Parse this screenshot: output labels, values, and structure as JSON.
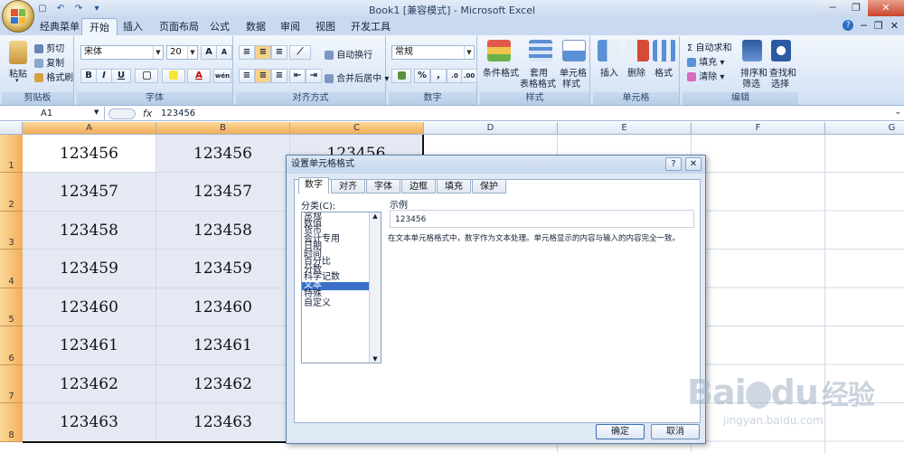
{
  "window": {
    "title": "Book1 [兼容模式] - Microsoft Excel",
    "controls": {
      "minimize": "─",
      "restore": "❐",
      "close": "✕"
    }
  },
  "qat": {
    "save_icon": "save-icon",
    "undo": "↶",
    "redo": "↷",
    "more": "▾"
  },
  "tabs": [
    {
      "label": "经典菜单",
      "active": false
    },
    {
      "label": "开始",
      "active": true
    },
    {
      "label": "插入",
      "active": false
    },
    {
      "label": "页面布局",
      "active": false
    },
    {
      "label": "公式",
      "active": false
    },
    {
      "label": "数据",
      "active": false
    },
    {
      "label": "审阅",
      "active": false
    },
    {
      "label": "视图",
      "active": false
    },
    {
      "label": "开发工具",
      "active": false
    }
  ],
  "tab_right": {
    "help": "?",
    "min": "─",
    "restore": "❐",
    "close": "✕"
  },
  "ribbon": {
    "clipboard": {
      "label": "剪贴板",
      "paste": "粘贴",
      "cut": "剪切",
      "copy": "复制",
      "format_painter": "格式刷"
    },
    "font": {
      "label": "字体",
      "font_name": "宋体",
      "font_size": "20",
      "bold": "B",
      "italic": "I",
      "underline": "U",
      "grow": "A",
      "shrink": "A",
      "font_color": "A",
      "phonetic": "wén"
    },
    "alignment": {
      "label": "对齐方式",
      "wrap": "自动换行",
      "merge": "合并后居中"
    },
    "number": {
      "label": "数字",
      "format": "常规",
      "currency": "▾",
      "percent": "%",
      "comma": ",",
      "inc": ".0",
      "dec": ".00"
    },
    "styles": {
      "label": "样式",
      "conditional": "条件格式",
      "table": "套用",
      "table2": "表格格式",
      "cell_styles": "单元格",
      "cell_styles2": "样式"
    },
    "cells": {
      "label": "单元格",
      "insert": "插入",
      "delete": "删除",
      "format": "格式"
    },
    "editing": {
      "label": "编辑",
      "autosum": "Σ 自动求和",
      "fill": "填充",
      "clear": "清除",
      "sort": "排序和",
      "sort2": "筛选",
      "find": "查找和",
      "find2": "选择"
    }
  },
  "formula_bar": {
    "name_box": "A1",
    "fx": "fx",
    "value": "123456"
  },
  "columns": [
    "A",
    "B",
    "C",
    "D",
    "E",
    "F",
    "G"
  ],
  "rows": [
    "1",
    "2",
    "3",
    "4",
    "5",
    "6",
    "7",
    "8"
  ],
  "cells": {
    "A": [
      "123456",
      "123457",
      "123458",
      "123459",
      "123460",
      "123461",
      "123462",
      "123463"
    ],
    "B": [
      "123456",
      "123457",
      "123458",
      "123459",
      "123460",
      "123461",
      "123462",
      "123463"
    ],
    "C": [
      "123456",
      "",
      "",
      "",
      "",
      "",
      "",
      ""
    ]
  },
  "dialog": {
    "title": "设置单元格格式",
    "help": "?",
    "close": "✕",
    "tabs": [
      "数字",
      "对齐",
      "字体",
      "边框",
      "填充",
      "保护"
    ],
    "category_label": "分类(C):",
    "categories": [
      "常规",
      "数值",
      "货币",
      "会计专用",
      "日期",
      "时间",
      "百分比",
      "分数",
      "科学记数",
      "文本",
      "特殊",
      "自定义"
    ],
    "selected_category": "文本",
    "sample_label": "示例",
    "sample_value": "123456",
    "description": "在文本单元格格式中，数字作为文本处理。单元格显示的内容与输入的内容完全一致。",
    "ok": "确定",
    "cancel": "取消"
  },
  "watermark": {
    "brand": "Bai",
    "brand2": "du",
    "brand3": "经验",
    "url": "jingyan.baidu.com"
  }
}
